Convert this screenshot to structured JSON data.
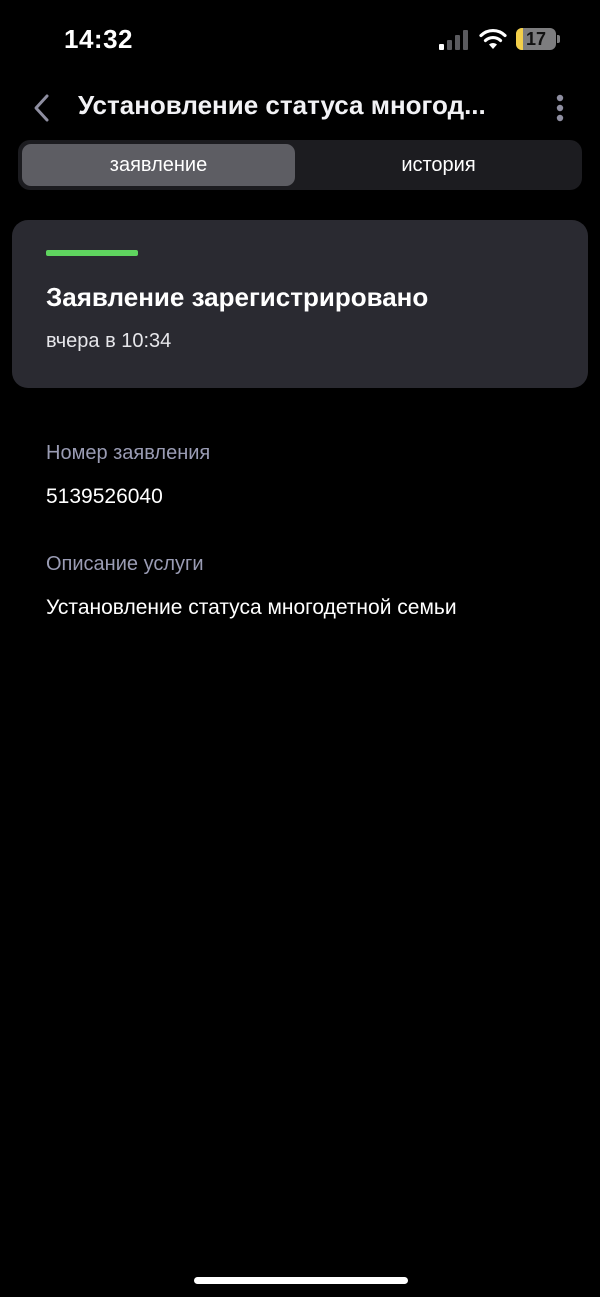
{
  "status_bar": {
    "time": "14:32",
    "battery_level": "17",
    "battery_fraction": 0.17,
    "icons": [
      "cellular-signal-icon",
      "wifi-icon",
      "battery-icon"
    ]
  },
  "header": {
    "title": "Установление статуса многод...",
    "back_icon": "chevron-left-icon",
    "more_icon": "more-vertical-icon"
  },
  "tabs": [
    {
      "label": "заявление",
      "active": true
    },
    {
      "label": "история",
      "active": false
    }
  ],
  "status_card": {
    "title": "Заявление зарегистрировано",
    "time": "вчера в 10:34",
    "indicator_color": "#5fd45f"
  },
  "details": {
    "number_label": "Номер заявления",
    "number_value": "5139526040",
    "description_label": "Описание услуги",
    "description_value": "Установление статуса многодетной семьи"
  },
  "colors": {
    "background": "#000000",
    "card": "#2a2a31",
    "tab_active": "#5d5d63",
    "label": "#9a9cb4",
    "accent_green": "#5fd45f",
    "battery_low": "#f3cf4a"
  }
}
